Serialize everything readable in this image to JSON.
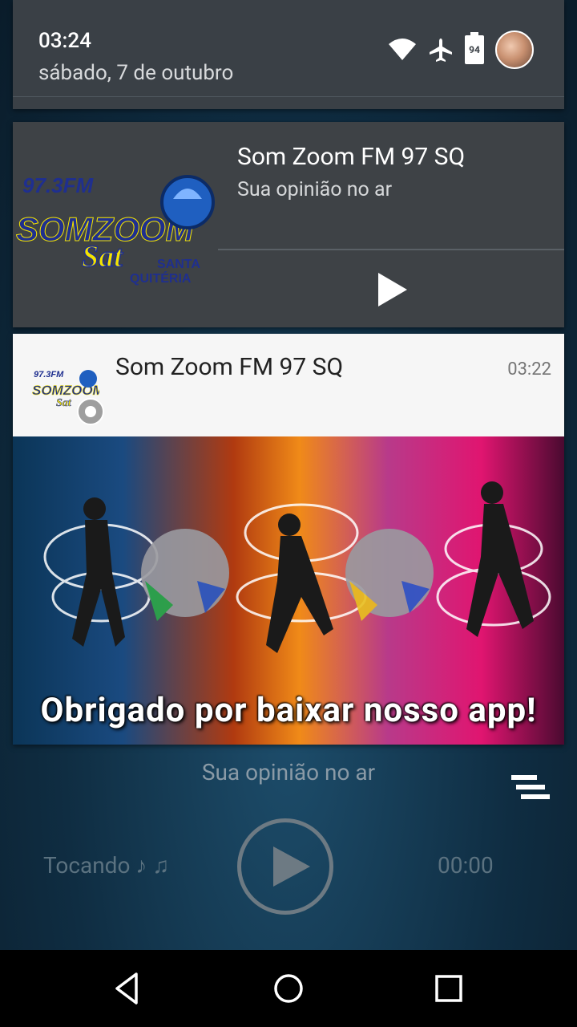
{
  "status": {
    "time": "03:24",
    "date": "sábado, 7 de outubro",
    "battery": "94",
    "icons": [
      "wifi-icon",
      "airplane-icon",
      "battery-icon",
      "user-avatar"
    ]
  },
  "media_notification": {
    "title": "Som Zoom FM 97 SQ",
    "subtitle": "Sua opinião no ar",
    "logo": {
      "frequency": "97.3FM",
      "brand": "SOMZOOM",
      "sub": "Sat",
      "location_line1": "SANTA",
      "location_line2": "QUITÉRIA"
    }
  },
  "app_notification": {
    "app_name": "Som Zoom FM 97 SQ",
    "time": "03:22",
    "image_caption": "Obrigado por baixar nosso app!"
  },
  "player": {
    "subtitle": "Sua opinião no ar",
    "status": "Tocando ♪ ♫",
    "elapsed": "00:00"
  },
  "colors": {
    "shade_bg": "#3a4046",
    "card_bg": "#f6f6f6",
    "logo_blue": "#1f2f8f",
    "logo_yellow": "#f4e400"
  }
}
